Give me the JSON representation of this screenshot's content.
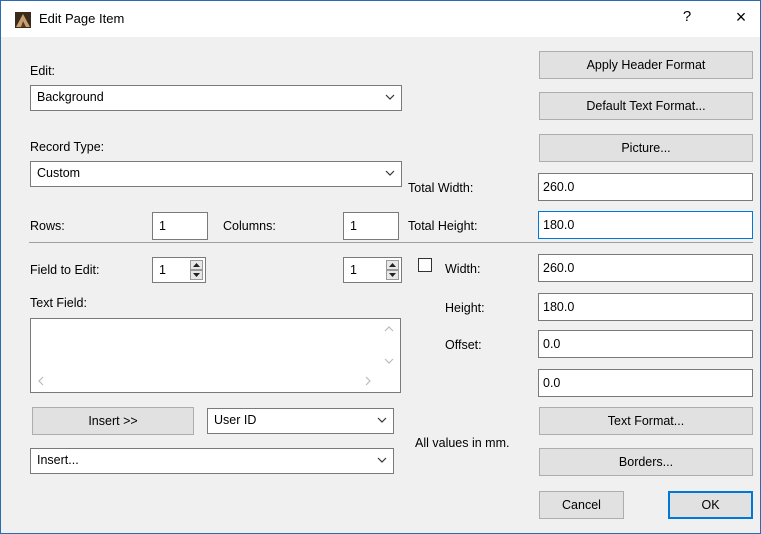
{
  "window": {
    "title": "Edit Page Item",
    "help_label": "?",
    "close_label": "×"
  },
  "edit": {
    "label": "Edit:",
    "value": "Background"
  },
  "record_type": {
    "label": "Record Type:",
    "value": "Custom"
  },
  "rows": {
    "label": "Rows:",
    "value": "1"
  },
  "columns": {
    "label": "Columns:",
    "value": "1"
  },
  "field_to_edit": {
    "label": "Field to Edit:",
    "value1": "1",
    "value2": "1"
  },
  "text_field": {
    "label": "Text Field:",
    "value": ""
  },
  "insert": {
    "button_label": "Insert >>",
    "type_value": "User ID",
    "insert_value": "Insert..."
  },
  "buttons": {
    "apply_header_format": "Apply Header Format",
    "default_text_format": "Default Text Format...",
    "picture": "Picture...",
    "text_format": "Text Format...",
    "borders": "Borders...",
    "cancel": "Cancel",
    "ok": "OK"
  },
  "size": {
    "total_width_label": "Total Width:",
    "total_width": "260.0",
    "total_height_label": "Total Height:",
    "total_height": "180.0",
    "width_label": "Width:",
    "width": "260.0",
    "height_label": "Height:",
    "height": "180.0",
    "offset_label": "Offset:",
    "offset_x": "0.0",
    "offset_y": "0.0",
    "width_checkbox_checked": false
  },
  "units_note": "All values in mm.",
  "colors": {
    "accent": "#0078d7",
    "window_bg": "#f0f0f0",
    "button_bg": "#e1e1e1"
  }
}
